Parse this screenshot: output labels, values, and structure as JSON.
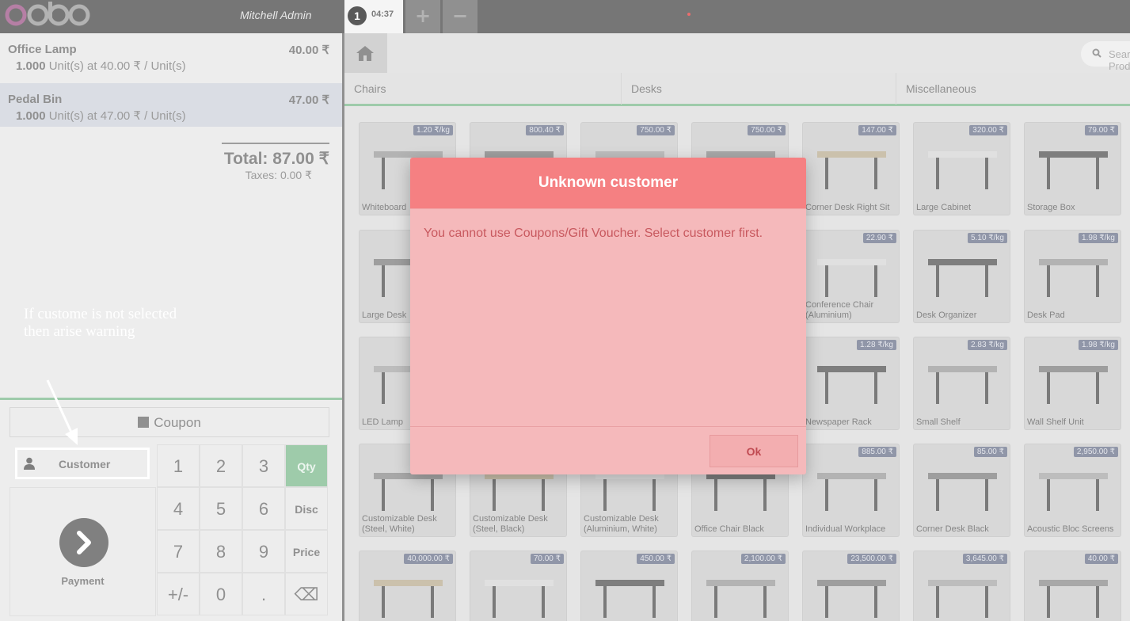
{
  "header": {
    "logo_text": "odoo",
    "user_name": "Mitchell Admin",
    "order_number": "1",
    "order_time": "04:37",
    "add_order_label": "+",
    "remove_order_label": "−"
  },
  "orderlines": [
    {
      "name": "Office Lamp",
      "price": "40.00 ₹",
      "qty": "1.000",
      "info": " Unit(s) at 40.00 ₹ / Unit(s)"
    },
    {
      "name": "Pedal Bin",
      "price": "47.00 ₹",
      "qty": "1.000",
      "info": " Unit(s) at 47.00 ₹ / Unit(s)"
    }
  ],
  "summary": {
    "total": "Total: 87.00 ₹",
    "taxes": "Taxes: 0.00 ₹"
  },
  "annotation": {
    "line1": "If custome is not selected",
    "line2": "then arise warning"
  },
  "actions": {
    "coupon_label": "Coupon",
    "customer_label": "Customer",
    "payment_label": "Payment"
  },
  "numpad": {
    "keys": [
      "1",
      "2",
      "3",
      "4",
      "5",
      "6",
      "7",
      "8",
      "9",
      "+/-",
      "0",
      "."
    ],
    "qty": "Qty",
    "disc": "Disc",
    "price": "Price",
    "backspace": "⌫"
  },
  "search": {
    "placeholder": "Search Products"
  },
  "categories": [
    "Chairs",
    "Desks",
    "Miscellaneous"
  ],
  "products": [
    {
      "name": "Whiteboard",
      "price": "1.20 ₹/kg"
    },
    {
      "name": "",
      "price": "800.40 ₹"
    },
    {
      "name": "",
      "price": "750.00 ₹"
    },
    {
      "name": "",
      "price": "750.00 ₹"
    },
    {
      "name": "Corner Desk Right Sit",
      "price": "147.00 ₹"
    },
    {
      "name": "Large Cabinet",
      "price": "320.00 ₹"
    },
    {
      "name": "Storage Box",
      "price": "79.00 ₹"
    },
    {
      "name": "Large Desk",
      "price": ""
    },
    {
      "name": "",
      "price": ""
    },
    {
      "name": "",
      "price": ""
    },
    {
      "name": "",
      "price": ""
    },
    {
      "name": "Conference Chair (Aluminium)",
      "price": "22.90 ₹"
    },
    {
      "name": "Desk Organizer",
      "price": "5.10 ₹/kg"
    },
    {
      "name": "Desk Pad",
      "price": "1.98 ₹/kg"
    },
    {
      "name": "LED Lamp",
      "price": ""
    },
    {
      "name": "",
      "price": ""
    },
    {
      "name": "",
      "price": ""
    },
    {
      "name": "",
      "price": ""
    },
    {
      "name": "Newspaper Rack",
      "price": "1.28 ₹/kg"
    },
    {
      "name": "Small Shelf",
      "price": "2.83 ₹/kg"
    },
    {
      "name": "Wall Shelf Unit",
      "price": "1.98 ₹/kg"
    },
    {
      "name": "Customizable Desk (Steel, White)",
      "price": ""
    },
    {
      "name": "Customizable Desk (Steel, Black)",
      "price": ""
    },
    {
      "name": "Customizable Desk (Aluminium, White)",
      "price": ""
    },
    {
      "name": "Office Chair Black",
      "price": ""
    },
    {
      "name": "Individual Workplace",
      "price": "885.00 ₹"
    },
    {
      "name": "Corner Desk Black",
      "price": "85.00 ₹"
    },
    {
      "name": "Acoustic Bloc Screens",
      "price": "2,950.00 ₹"
    },
    {
      "name": "",
      "price": "40,000.00 ₹"
    },
    {
      "name": "",
      "price": "70.00 ₹"
    },
    {
      "name": "",
      "price": "450.00 ₹"
    },
    {
      "name": "",
      "price": "2,100.00 ₹"
    },
    {
      "name": "",
      "price": "23,500.00 ₹"
    },
    {
      "name": "",
      "price": "3,645.00 ₹"
    },
    {
      "name": "",
      "price": "40.00 ₹"
    }
  ],
  "dialog": {
    "title": "Unknown customer",
    "message": "You cannot use Coupons/Gift Voucher. Select customer first.",
    "ok_label": "Ok"
  }
}
